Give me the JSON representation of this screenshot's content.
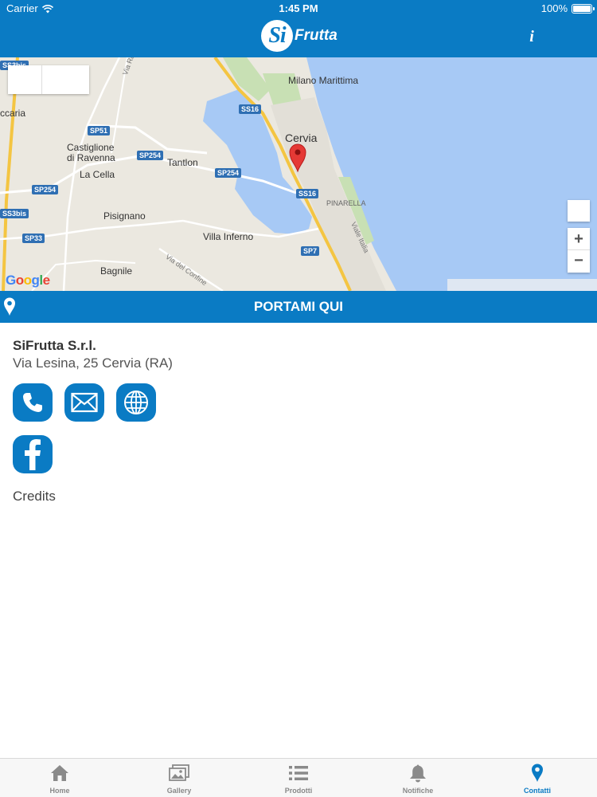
{
  "status_bar": {
    "carrier": "Carrier",
    "time": "1:45 PM",
    "battery": "100%"
  },
  "header": {
    "logo_badge": "Si",
    "logo_text": "Frutta",
    "info_label": "i"
  },
  "map": {
    "places": [
      {
        "name": "Milano Marittima",
        "id": "milano-marittima"
      },
      {
        "name": "Cervia",
        "id": "cervia"
      },
      {
        "name": "PINARELLA",
        "id": "pinarella"
      },
      {
        "name": "Castiglione",
        "id": "castiglione"
      },
      {
        "name": "di Ravenna",
        "id": "di-ravenna"
      },
      {
        "name": "La Cella",
        "id": "la-cella"
      },
      {
        "name": "Tantlon",
        "id": "tantlon"
      },
      {
        "name": "Pisignano",
        "id": "pisignano"
      },
      {
        "name": "Villa Inferno",
        "id": "villa-inferno"
      },
      {
        "name": "Bagnile",
        "id": "bagnile"
      },
      {
        "name": "ccaria",
        "id": "ccaria"
      },
      {
        "name": "Via Ragazze",
        "id": "via-ragazze"
      },
      {
        "name": "Via del Confine",
        "id": "via-del-confine"
      },
      {
        "name": "Viale Italia",
        "id": "viale-italia"
      }
    ],
    "roads": [
      {
        "name": "SS3bis",
        "id": "ss3bis-top"
      },
      {
        "name": "SS16",
        "id": "ss16-top"
      },
      {
        "name": "SP51",
        "id": "sp51"
      },
      {
        "name": "SP254",
        "id": "sp254-a"
      },
      {
        "name": "SP254",
        "id": "sp254-b"
      },
      {
        "name": "SP254",
        "id": "sp254-c"
      },
      {
        "name": "SS16",
        "id": "ss16-mid"
      },
      {
        "name": "SS3bis",
        "id": "ss3bis-left"
      },
      {
        "name": "SP33",
        "id": "sp33"
      },
      {
        "name": "SP7",
        "id": "sp7"
      }
    ],
    "zoom_in": "+",
    "zoom_out": "−",
    "attribution": "Google"
  },
  "navigate": {
    "label": "PORTAMI QUI"
  },
  "contact": {
    "company": "SiFrutta S.r.l.",
    "address": "Via Lesina, 25 Cervia (RA)",
    "buttons": [
      "phone-icon",
      "mail-icon",
      "globe-icon",
      "facebook-icon"
    ],
    "credits": "Credits"
  },
  "tabs": [
    {
      "label": "Home",
      "icon": "home-icon",
      "active": false
    },
    {
      "label": "Gallery",
      "icon": "gallery-icon",
      "active": false
    },
    {
      "label": "Prodotti",
      "icon": "list-icon",
      "active": false
    },
    {
      "label": "Notifiche",
      "icon": "bell-icon",
      "active": false
    },
    {
      "label": "Contatti",
      "icon": "map-pin-icon",
      "active": true
    }
  ],
  "colors": {
    "primary": "#0a7bc4",
    "tab_inactive": "#888888",
    "sea": "#a7c9f5",
    "land": "#ebe8e0"
  }
}
